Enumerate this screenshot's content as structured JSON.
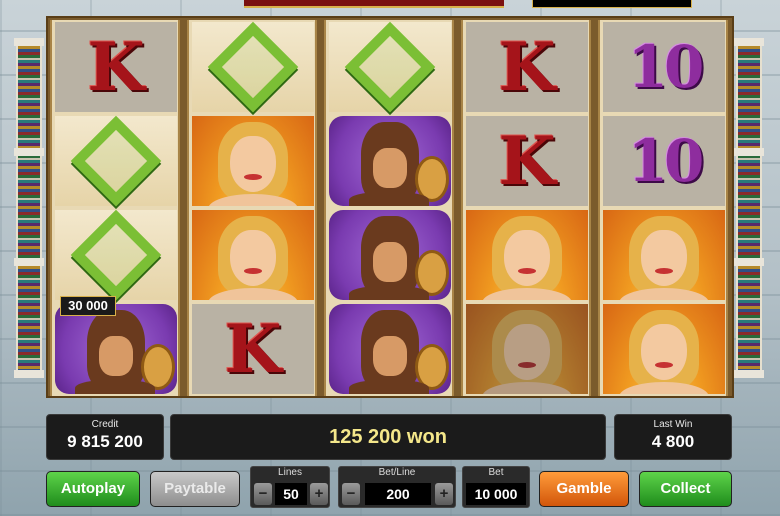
{
  "reels": [
    [
      "K",
      "Q",
      "Q",
      "hero"
    ],
    [
      "Q",
      "woman",
      "woman",
      "K"
    ],
    [
      "Q",
      "hero",
      "hero",
      "hero"
    ],
    [
      "K",
      "K",
      "woman",
      "woman"
    ],
    [
      "10",
      "10",
      "woman",
      "woman"
    ]
  ],
  "win_tag": "30 000",
  "credit": {
    "caption": "Credit",
    "value": "9 815 200"
  },
  "won_message": "125 200 won",
  "last_win": {
    "caption": "Last Win",
    "value": "4 800"
  },
  "controls": {
    "autoplay_label": "Autoplay",
    "paytable_label": "Paytable",
    "lines": {
      "caption": "Lines",
      "value": "50",
      "minus": "−",
      "plus": "+"
    },
    "bet_line": {
      "caption": "Bet/Line",
      "value": "200",
      "minus": "−",
      "plus": "+"
    },
    "bet": {
      "caption": "Bet",
      "value": "10 000"
    },
    "gamble_label": "Gamble",
    "collect_label": "Collect"
  },
  "symbol_text": {
    "K": "K",
    "ten": "10"
  }
}
